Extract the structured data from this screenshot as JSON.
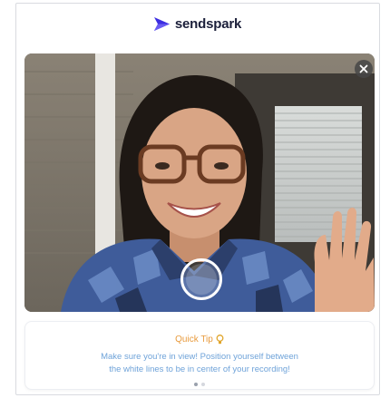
{
  "brand": {
    "name": "sendspark",
    "logo_icon": "sendspark-logo-icon",
    "logo_color": "#3b2de0"
  },
  "video": {
    "close_icon": "close-icon",
    "record_icon": "record-button-icon"
  },
  "tip": {
    "title": "Quick Tip",
    "title_icon": "lightbulb-icon",
    "line1": "Make sure you're in view! Position yourself between",
    "line2": "the white lines to be in center of your recording!",
    "title_color": "#e89a3c",
    "text_color": "#6fa3d9"
  },
  "pagination": {
    "pages": 2,
    "current": 1
  }
}
